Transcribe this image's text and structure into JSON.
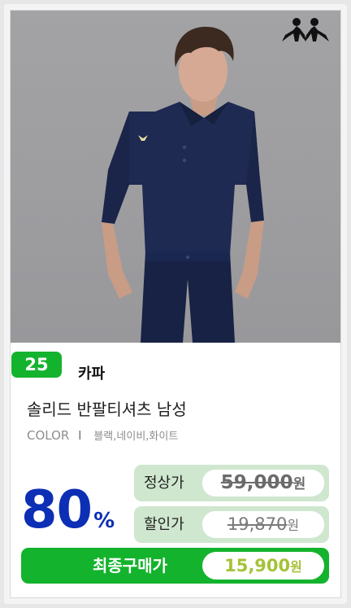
{
  "rank": "25",
  "brand": "카파",
  "product": {
    "title": "솔리드 반팔티셔츠 남성",
    "color_label": "COLOR",
    "color_sep": "I",
    "colors": "블랙,네이비,화이트"
  },
  "discount": {
    "value": "80",
    "unit": "%"
  },
  "prices": {
    "regular_label": "정상가",
    "regular_value": "59,000",
    "sale_label": "할인가",
    "sale_value": "19,870",
    "final_label": "최종구매가",
    "final_value": "15,900",
    "currency": "원"
  },
  "icons": {
    "logo": "kappa-logo",
    "photo": "product-photo"
  },
  "colors_theme": {
    "accent": "#14b32d",
    "discount": "#0d2fb5",
    "price_bg": "#cfe7cf",
    "final_price": "#a6c238"
  }
}
